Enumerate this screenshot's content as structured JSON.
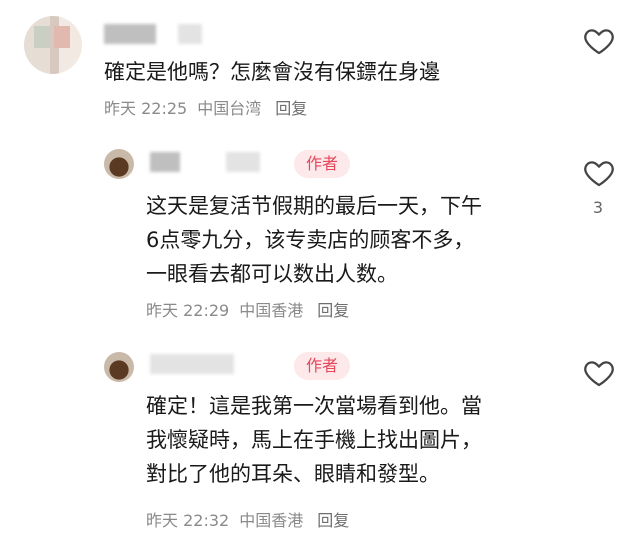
{
  "comments": [
    {
      "text": "確定是他嗎？怎麼會沒有保鏢在身邊",
      "time": "昨天 22:25",
      "location": "中国台湾",
      "reply_label": "回复",
      "likes": ""
    },
    {
      "badge": "作者",
      "lines": [
        "这天是复活节假期的最后一天，下午",
        "6点零九分，该专卖店的顾客不多，",
        "一眼看去都可以数出人数。"
      ],
      "time": "昨天 22:29",
      "location": "中国香港",
      "reply_label": "回复",
      "likes": "3"
    },
    {
      "badge": "作者",
      "lines": [
        "確定！這是我第一次當場看到他。當",
        "我懷疑時，馬上在手機上找出圖片，",
        "對比了他的耳朵、眼睛和發型。"
      ],
      "time": "昨天 22:32",
      "location": "中国香港",
      "reply_label": "回复",
      "likes": ""
    }
  ],
  "icons": {
    "like": "heart-outline-icon"
  },
  "colors": {
    "badge_bg": "#fde8ea",
    "badge_text": "#e5475b",
    "meta": "#8a8a8a"
  }
}
